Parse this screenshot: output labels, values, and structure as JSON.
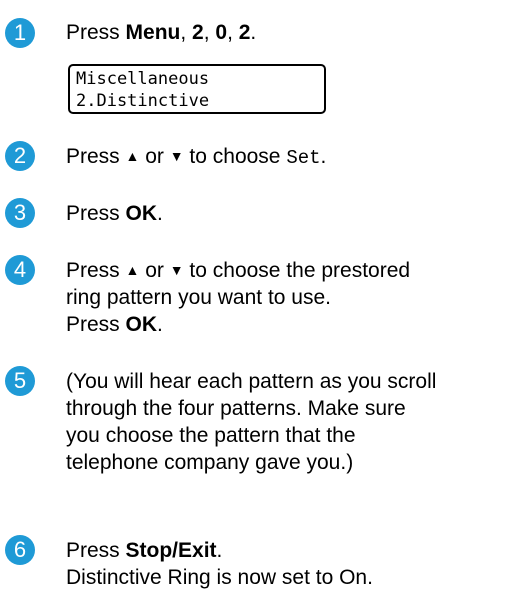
{
  "steps": [
    {
      "number": "1",
      "press": "Press ",
      "menu": "Menu",
      "sep1": ", ",
      "k2": "2",
      "sep2": ", ",
      "k0": "0",
      "sep3": ", ",
      "k2b": "2",
      "end": "."
    },
    {
      "number": "2",
      "press": "Press ",
      "up": "▲",
      "or": " or ",
      "down": "▼",
      "choose": " to choose ",
      "value": "Set",
      "end": "."
    },
    {
      "number": "3",
      "press": "Press ",
      "ok": "OK",
      "end": "."
    },
    {
      "number": "4",
      "press": "Press ",
      "up": "▲",
      "or": " or ",
      "down": "▼",
      "choose": " to choose the prestored",
      "line2": "ring pattern you want to use.",
      "press2": "Press ",
      "ok": "OK",
      "end": "."
    },
    {
      "number": "5",
      "line1": "(You will hear each pattern as you scroll",
      "line2": "through the four patterns. Make sure",
      "line3": "you choose the pattern that the",
      "line4": "telephone company gave you.)"
    },
    {
      "number": "6",
      "press": "Press ",
      "stop": "Stop/Exit",
      "end": ".",
      "line2": "Distinctive Ring is now set to On."
    }
  ],
  "lcd": {
    "line1": "Miscellaneous",
    "line2": "2.Distinctive"
  },
  "colors": {
    "step_circle": "#1f9ad6"
  }
}
